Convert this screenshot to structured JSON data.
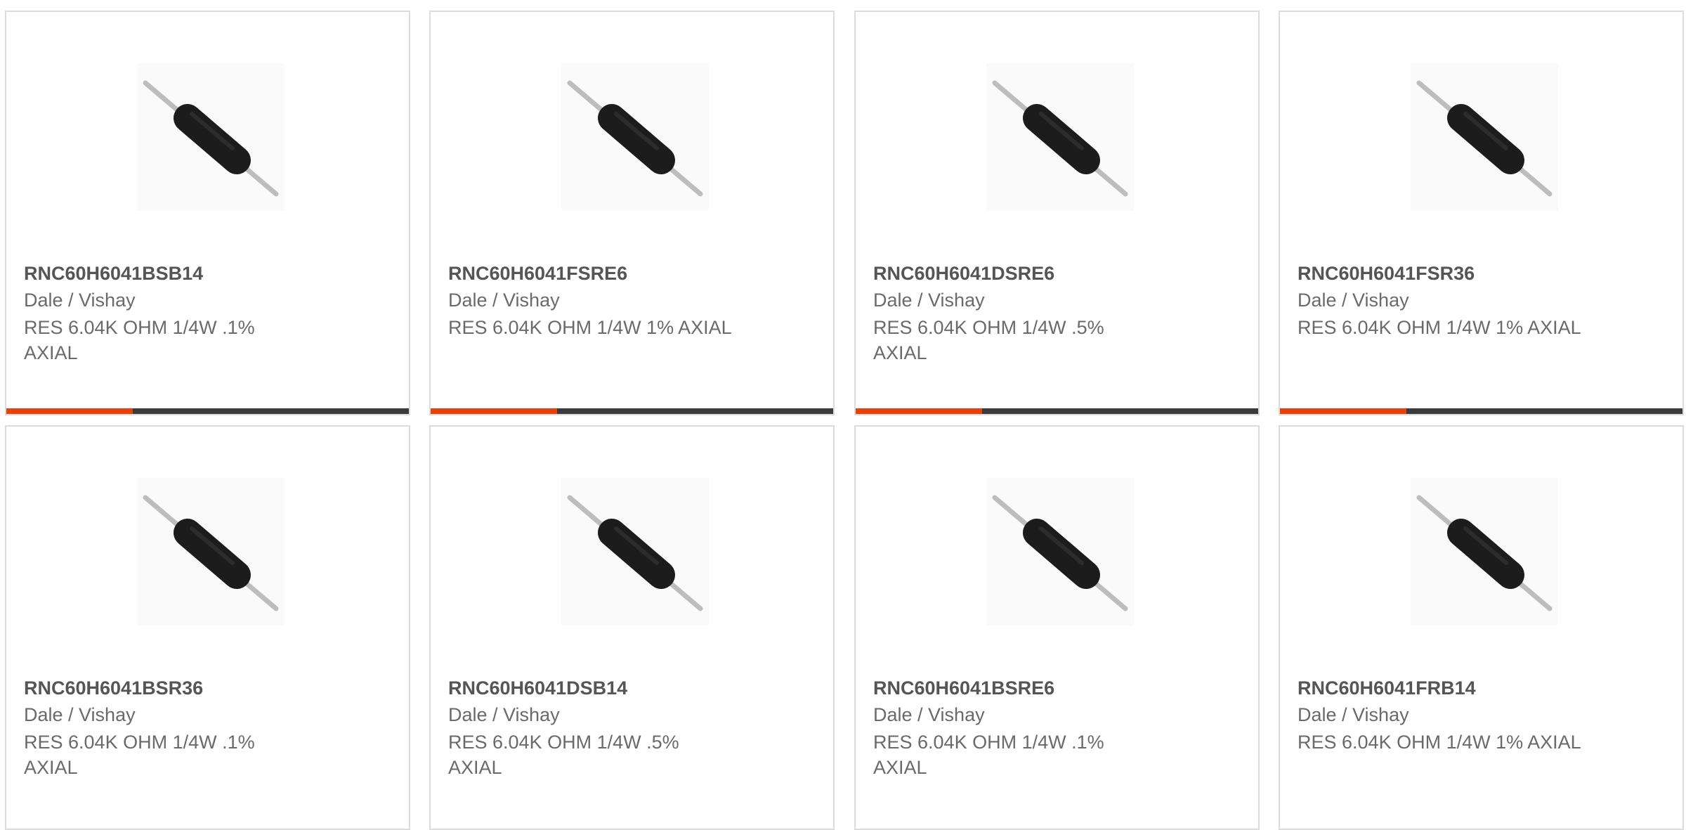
{
  "colors": {
    "accent": "#e8410b",
    "bar": "#3b3b3b",
    "border": "#dcdcdc"
  },
  "icons": {
    "product_image": "axial-resistor-image"
  },
  "products": [
    {
      "part_number": "RNC60H6041BSB14",
      "manufacturer": "Dale / Vishay",
      "description": "RES 6.04K OHM 1/4W .1% AXIAL"
    },
    {
      "part_number": "RNC60H6041FSRE6",
      "manufacturer": "Dale / Vishay",
      "description": "RES 6.04K OHM 1/4W 1% AXIAL"
    },
    {
      "part_number": "RNC60H6041DSRE6",
      "manufacturer": "Dale / Vishay",
      "description": "RES 6.04K OHM 1/4W .5% AXIAL"
    },
    {
      "part_number": "RNC60H6041FSR36",
      "manufacturer": "Dale / Vishay",
      "description": "RES 6.04K OHM 1/4W 1% AXIAL"
    },
    {
      "part_number": "RNC60H6041BSR36",
      "manufacturer": "Dale / Vishay",
      "description": "RES 6.04K OHM 1/4W .1% AXIAL"
    },
    {
      "part_number": "RNC60H6041DSB14",
      "manufacturer": "Dale / Vishay",
      "description": "RES 6.04K OHM 1/4W .5% AXIAL"
    },
    {
      "part_number": "RNC60H6041BSRE6",
      "manufacturer": "Dale / Vishay",
      "description": "RES 6.04K OHM 1/4W .1% AXIAL"
    },
    {
      "part_number": "RNC60H6041FRB14",
      "manufacturer": "Dale / Vishay",
      "description": "RES 6.04K OHM 1/4W 1% AXIAL"
    }
  ]
}
